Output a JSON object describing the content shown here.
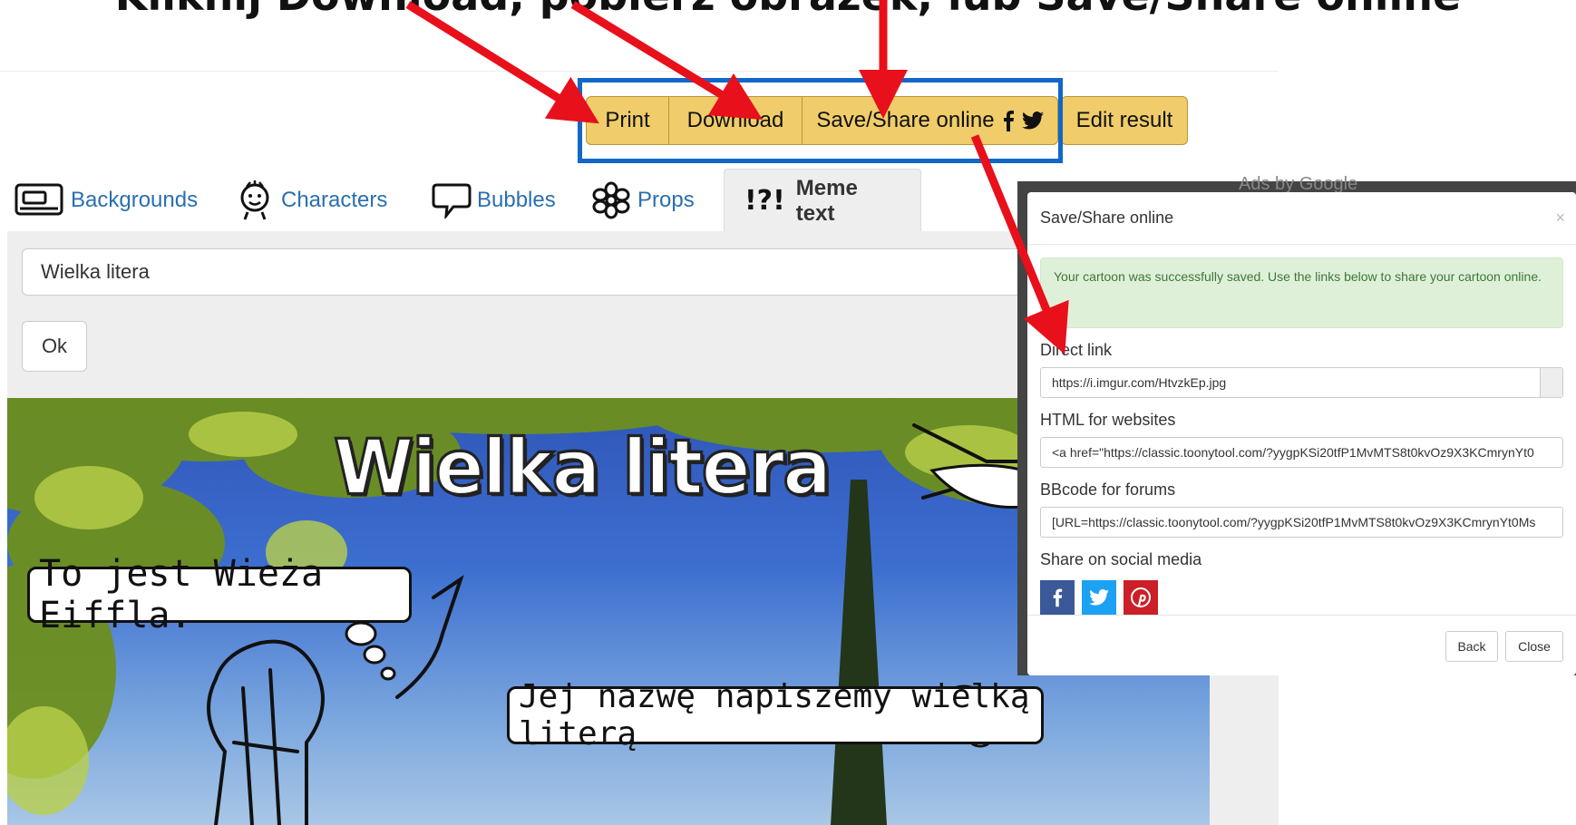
{
  "caption": {
    "text": "Kliknij Download, pobierz obrazek, lub Save/Share online"
  },
  "toolbar": {
    "print_label": "Print",
    "download_label": "Download",
    "share_label": "Save/Share online",
    "edit_label": "Edit result"
  },
  "tabs": [
    {
      "label": "Backgrounds",
      "icon": "background-icon"
    },
    {
      "label": "Characters",
      "icon": "character-icon"
    },
    {
      "label": "Bubbles",
      "icon": "bubble-icon"
    },
    {
      "label": "Props",
      "icon": "flower-icon"
    },
    {
      "label": "Meme text",
      "icon": "exclamation-icon",
      "active": true,
      "glyph": "!?!"
    }
  ],
  "meme": {
    "input_value": "Wielka litera",
    "ok_label": "Ok"
  },
  "cartoon": {
    "title": "Wielka litera",
    "bubble1": "To jest Wieża Eiffla.",
    "bubble2": "Jej nazwę napiszemy wielką literą"
  },
  "ads": {
    "label": "Ads by Google"
  },
  "modal": {
    "title": "Save/Share online",
    "close_symbol": "×",
    "alert": "Your cartoon was successfully saved. Use the links below to share your cartoon online.",
    "direct_label": "Direct link",
    "direct_value": "https://i.imgur.com/HtvzkEp.jpg",
    "html_label": "HTML for websites",
    "html_value": "<a href=\"https://classic.toonytool.com/?yygpKSi20tfP1MvMTS8t0kvOz9X3KCmrynYt0",
    "bbcode_label": "BBcode for forums",
    "bbcode_value": "[URL=https://classic.toonytool.com/?yygpKSi20tfP1MvMTS8t0kvOz9X3KCmrynYt0Ms",
    "social_label": "Share on social media",
    "back_label": "Back",
    "close_label": "Close"
  },
  "colors": {
    "toolbar_button": "#f0cd6a",
    "highlight": "#1267c8",
    "arrow": "#e8101a",
    "alert_bg": "#dff0d8"
  }
}
